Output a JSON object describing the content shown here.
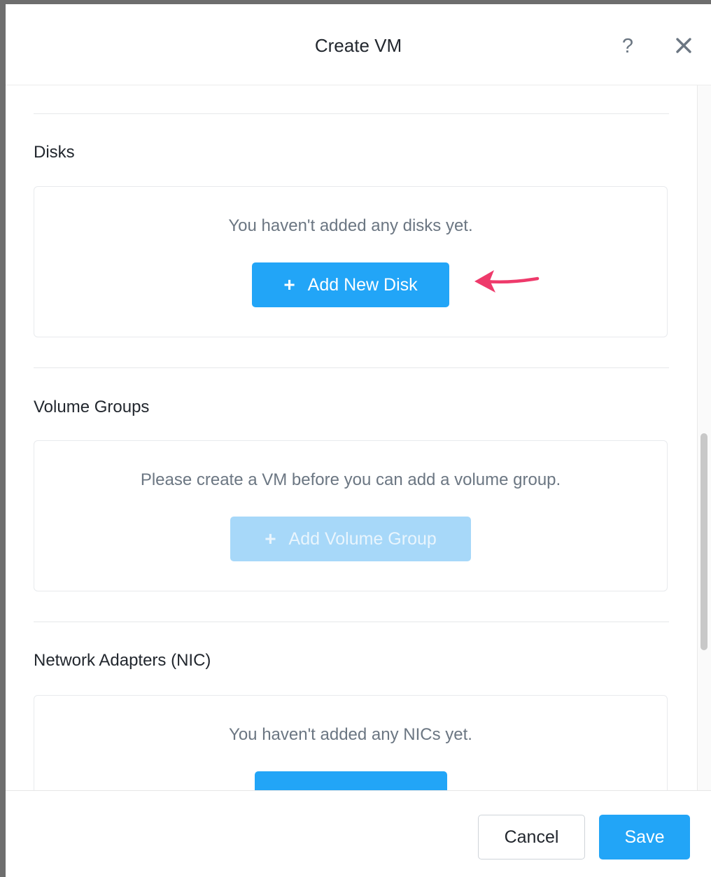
{
  "dialog": {
    "title": "Create VM",
    "help_glyph": "?",
    "close_icon": "close-icon"
  },
  "sections": {
    "disks": {
      "title": "Disks",
      "empty_message": "You haven't added any disks yet.",
      "button_label": "Add New Disk",
      "button_icon": "plus-icon"
    },
    "volume_groups": {
      "title": "Volume Groups",
      "empty_message": "Please create a VM before you can add a volume group.",
      "button_label": "Add Volume Group",
      "button_icon": "plus-icon",
      "button_disabled": true
    },
    "nics": {
      "title": "Network Adapters (NIC)",
      "empty_message": "You haven't added any NICs yet."
    }
  },
  "annotation": {
    "arrow_color": "#ee3a6b"
  },
  "footer": {
    "cancel_label": "Cancel",
    "save_label": "Save"
  },
  "colors": {
    "primary": "#22a5f7",
    "primary_disabled": "#a7d8f9"
  }
}
